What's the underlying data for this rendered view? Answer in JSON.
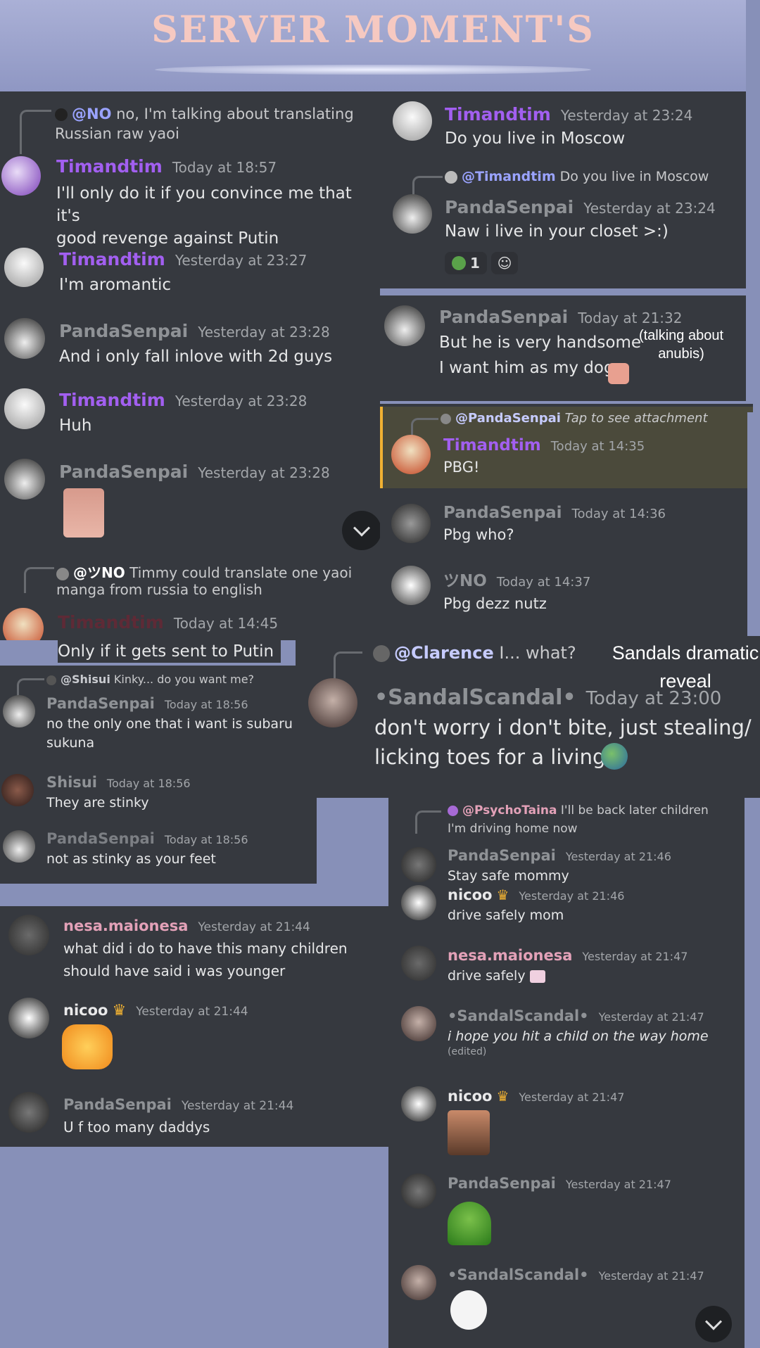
{
  "banner": {
    "title": "SERVER MOMENT'S"
  },
  "colors": {
    "background": "#8790b8",
    "panel": "#36393f",
    "username_purple": "#a25ff0",
    "mention_bg": "#c6cbff",
    "highlight_bg": "#4b4a3b",
    "highlight_border": "#f0b132"
  },
  "left1": {
    "reply1": {
      "mention": "@NO",
      "text": "no, I'm talking about translating",
      "text2": "Russian raw yaoi"
    },
    "m1": {
      "name": "Timandtim",
      "ts": "Today at 18:57",
      "l1": "I'll only do it if you convince me that it's",
      "l2": "good revenge against Putin"
    },
    "m2": {
      "name": "Timandtim",
      "ts": "Yesterday at 23:27",
      "l1": "I'm aromantic"
    },
    "m3": {
      "name": "PandaSenpai",
      "ts": "Yesterday at 23:28",
      "l1": "And i only fall inlove with 2d guys"
    },
    "m4": {
      "name": "Timandtim",
      "ts": "Yesterday at 23:28",
      "l1": "Huh"
    },
    "m5": {
      "name": "PandaSenpai",
      "ts": "Yesterday at 23:28"
    },
    "reply2": {
      "mention": "@ツNO",
      "text": "Timmy could translate one yaoi",
      "text2": "manga from russia to english"
    },
    "m6": {
      "name": "Timandtim",
      "ts": "Today at 14:45",
      "l1": "Only if it gets sent to Putin"
    }
  },
  "left2": {
    "reply": {
      "mention": "@Shisui",
      "text": "Kinky... do you want me?"
    },
    "m1": {
      "name": "PandaSenpai",
      "ts": "Today at 18:56",
      "l1": "no the only one that i want is subaru or",
      "l2": "sukuna"
    },
    "m2": {
      "name": "Shisui",
      "ts": "Today at 18:56",
      "l1": "They are stinky"
    },
    "m3": {
      "name": "PandaSenpai",
      "ts": "Today at 18:56",
      "l1": "not as stinky as your feet"
    }
  },
  "left3": {
    "m1": {
      "name": "nesa.maionesa",
      "ts": "Yesterday at 21:44",
      "l1": "what did i do to have this many children",
      "l2": "should have said i was younger"
    },
    "m2": {
      "name": "nicoo",
      "ts": "Yesterday at 21:44"
    },
    "m3": {
      "name": "PandaSenpai",
      "ts": "Yesterday at 21:44",
      "l1": "U f too many daddys"
    }
  },
  "right1": {
    "m1": {
      "name": "Timandtim",
      "ts": "Yesterday at 23:24",
      "l1": "Do you live in Moscow"
    },
    "reply": {
      "mention": "@Timandtim",
      "text": "Do you live in Moscow"
    },
    "m2": {
      "name": "PandaSenpai",
      "ts": "Yesterday at 23:24",
      "l1": "Naw i live in your closet >:)"
    },
    "reaction_count": "1"
  },
  "right2": {
    "m1": {
      "name": "PandaSenpai",
      "ts": "Today at 21:32",
      "l1": "But he is very handsome",
      "l2": "I want him as my dog"
    },
    "caption": "(talking about anubis)"
  },
  "right3": {
    "reply": {
      "mention": "@PandaSenpai",
      "text": "Tap to see attachment"
    },
    "m1": {
      "name": "Timandtim",
      "ts": "Today at 14:35",
      "l1": "PBG!"
    },
    "m2": {
      "name": "PandaSenpai",
      "ts": "Today at 14:36",
      "l1": "Pbg who?"
    },
    "m3": {
      "name": "ツNO",
      "ts": "Today at 14:37",
      "l1": "Pbg dezz nutz"
    }
  },
  "middle": {
    "reply": {
      "mention": "@Clarence",
      "text": "I... what?"
    },
    "name": "•SandalScandal•",
    "ts": "Today at 23:00",
    "l1": "don't worry i don't bite, just stealing/",
    "l2": "licking  toes for a living",
    "caption": "Sandals dramatic reveal"
  },
  "right4": {
    "reply": {
      "mention": "@PsychoTaina",
      "text": "I'll be back later children",
      "text2": "I'm driving home now"
    },
    "m1": {
      "name": "PandaSenpai",
      "ts": "Yesterday at 21:46",
      "l1": "Stay safe mommy"
    },
    "m2": {
      "name": "nicoo",
      "ts": "Yesterday at 21:46",
      "l1": "drive safely mom"
    },
    "m3": {
      "name": "nesa.maionesa",
      "ts": "Yesterday at 21:47",
      "l1": "drive safely"
    },
    "m4": {
      "name": "•SandalScandal•",
      "ts": "Yesterday at 21:47",
      "l1": "i hope you hit a child on the way home",
      "edited": "(edited)"
    },
    "m5": {
      "name": "nicoo",
      "ts": "Yesterday at 21:47"
    },
    "m6": {
      "name": "PandaSenpai",
      "ts": "Yesterday at 21:47"
    },
    "m7": {
      "name": "•SandalScandal•",
      "ts": "Yesterday at 21:47"
    }
  }
}
